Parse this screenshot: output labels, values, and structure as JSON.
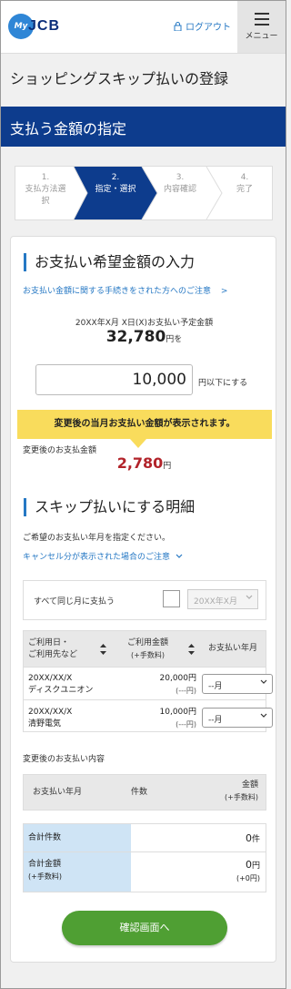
{
  "header": {
    "logo_my": "My",
    "logo_jcb": "JCB",
    "logout_label": "ログアウト",
    "menu_label": "メニュー"
  },
  "page_title": "ショッピングスキップ払いの登録",
  "section_band": "支払う金額の指定",
  "steps": [
    {
      "num": "1.",
      "label": "支払方法選択",
      "active": false
    },
    {
      "num": "2.",
      "label": "指定・選択",
      "active": true
    },
    {
      "num": "3.",
      "label": "内容確認",
      "active": false
    },
    {
      "num": "4.",
      "label": "完了",
      "active": false
    }
  ],
  "input_section": {
    "title": "お支払い希望金額の入力",
    "link": "お支払い金額に関する手続きをされた方へのご注意",
    "scheduled_label": "20XX年X月 X日(X)お支払い予定金額",
    "scheduled_amount": "32,780",
    "scheduled_suffix": "円を",
    "input_value": "10,000",
    "input_suffix": "円以下にする",
    "notice": "変更後の当月お支払い金額が表示されます。",
    "after_label": "変更後のお支払金額",
    "after_amount": "2,780",
    "after_unit": "円"
  },
  "skip_section": {
    "title": "スキップ払いにする明細",
    "instruction": "ご希望のお支払い年月を指定ください。",
    "cancel_link": "キャンセル分が表示された場合のご注意",
    "same_month_label": "すべて同じ月に支払う",
    "same_month_select": "20XX年X月",
    "table_headers": {
      "date_store_1": "ご利用日・",
      "date_store_2": "ご利用先など",
      "amount_1": "ご利用金額",
      "amount_2": "(+手数料)",
      "pay_month": "お支払い年月"
    },
    "rows": [
      {
        "date": "20XX/XX/X",
        "store": "ディスクユニオン",
        "amount": "20,000円",
        "fee": "(---円)",
        "select": "--月"
      },
      {
        "date": "20XX/XX/X",
        "store": "清野電気",
        "amount": "10,000円",
        "fee": "(---円)",
        "select": "--月"
      }
    ],
    "after_content_label": "変更後のお支払い内容",
    "content_headers": {
      "pay_month": "お支払い年月",
      "count": "件数",
      "amount_1": "金額",
      "amount_2": "(+手数料)"
    },
    "summary": {
      "total_count_label": "合計件数",
      "total_count_value": "0",
      "total_count_unit": "件",
      "total_amount_label": "合計金額",
      "total_amount_sub": "(+手数料)",
      "total_amount_value": "0",
      "total_amount_unit": "円",
      "total_amount_fee": "(+0円)"
    },
    "confirm_button": "確認画面へ"
  },
  "colors": {
    "band": "#0d3c8d",
    "accent_blue": "#2678c4",
    "notice_yellow": "#f9dc5c",
    "amount_red": "#b2232a",
    "cta_green": "#4f9f33",
    "summary_blue": "#cfe4f5"
  }
}
